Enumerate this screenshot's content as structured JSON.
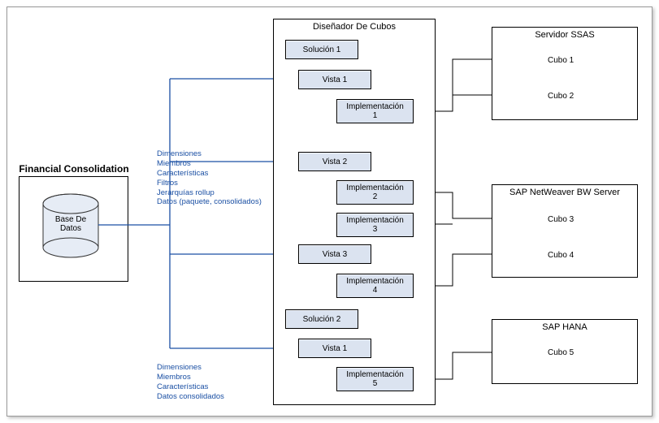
{
  "fc": {
    "title": "Financial Consolidation",
    "db_label": "Base De\nDatos"
  },
  "annotations": {
    "top": "Dimensiones\nMiembros\nCaracterísticas\nFiltros\nJerarquías rollup\nDatos (paquete, consolidados)",
    "bottom": "Dimensiones\nMiembros\nCaracterísticas\nDatos consolidados"
  },
  "designer": {
    "title": "Diseñador De Cubos",
    "sol1": "Solución 1",
    "v1": "Vista 1",
    "imp1": "Implementación\n1",
    "v2": "Vista 2",
    "imp2": "Implementación\n2",
    "imp3": "Implementación\n3",
    "v3": "Vista 3",
    "imp4": "Implementación\n4",
    "sol2": "Solución 2",
    "v1b": "Vista 1",
    "imp5": "Implementación\n5"
  },
  "servers": {
    "ssas": {
      "title": "Servidor SSAS",
      "c1": "Cubo 1",
      "c2": "Cubo 2"
    },
    "bw": {
      "title": "SAP NetWeaver BW Server",
      "c3": "Cubo 3",
      "c4": "Cubo 4"
    },
    "hana": {
      "title": "SAP HANA",
      "c5": "Cubo 5"
    }
  }
}
